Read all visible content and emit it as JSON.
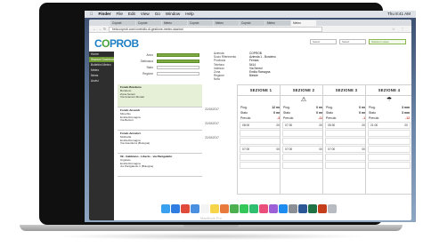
{
  "device": {
    "brand": "MacBook Pro"
  },
  "menubar": {
    "app": "Finder",
    "items": [
      "File",
      "Edit",
      "View",
      "Go",
      "Window",
      "Help"
    ],
    "status": "Thu 8:41 AM"
  },
  "browser": {
    "tabs": [
      "Coprob",
      "Coprob",
      "Meteo",
      "Coprob",
      "Meteo",
      "Coprob",
      "Meteo",
      "Meteo"
    ],
    "url": "beta.coprob.com/controllo-di-gestione-meteo-stazioni"
  },
  "app": {
    "logo_part1": "C",
    "logo_o": "O",
    "logo_part2": "PROB",
    "header": {
      "select1": "Select",
      "select2": "Select",
      "button": "Stazioni meteo"
    },
    "sidebar": [
      {
        "label": "Home",
        "active": false
      },
      {
        "label": "Stazioni Dashboard",
        "active": true
      },
      {
        "label": "Bollettini Meteo",
        "active": false
      },
      {
        "label": "Meteo",
        "active": false
      },
      {
        "label": "News",
        "active": false
      },
      {
        "label": "Avvisi",
        "active": false
      }
    ],
    "filters": [
      {
        "label": "Anno",
        "value": ""
      },
      {
        "label": "Settimana",
        "value": ""
      },
      {
        "label": "Stato",
        "value": ""
      },
      {
        "label": "Regione",
        "value": ""
      }
    ],
    "search_label": "Cerca",
    "info": {
      "labels": [
        "Azienda",
        "Socio Riferimento",
        "Provincia",
        "Telefono",
        "Indirizzo",
        "Zona",
        "Regione",
        "Nota"
      ],
      "values": [
        "COPROB",
        "Azienda 1 - Bondeno",
        "Ferrara",
        "",
        "5414",
        "Via Sereni",
        "Emilia Romagna",
        "Bietole"
      ]
    },
    "stations": [
      {
        "name": "Fondo Bondeno",
        "lines": [
          "Bondeno",
          "Zona Sereni",
          "Via Gramsci Monari"
        ],
        "active": true
      },
      {
        "name": "Fondo Ansardi",
        "lines": [
          "Minerbio",
          "Emilia Romagna",
          "Via Belzeri"
        ],
        "active": false
      },
      {
        "name": "Fondo Annalori",
        "lines": [
          "Molinella",
          "Emilia Romagna",
          "Via Giandurra (Bologna)"
        ],
        "active": false
      },
      {
        "name": "09 - Gabbiano - Liberto - via Panigaletto",
        "lines": [
          "Argelato",
          "Emilia Romagna",
          "via Panigaletto 1 (Bologna)"
        ],
        "active": false
      }
    ],
    "dates": [
      "21/08/2017",
      "21/08/2017",
      "21/08/2017"
    ],
    "sections": [
      {
        "title": "SEZIONE 1",
        "icon": "",
        "piog": "12 mm",
        "stato": "0 mm",
        "prev": "-36",
        "t1": [
          "08:00",
          "00"
        ],
        "t2": [
          "07:00",
          "00"
        ]
      },
      {
        "title": "SEZIONE 2",
        "icon": "⚠",
        "piog": "0 mm",
        "stato": "0 mm",
        "prev": "-118",
        "t1": [
          "07:30",
          "00"
        ],
        "t2": [
          "07:00",
          "00"
        ]
      },
      {
        "title": "SEZIONE 3",
        "icon": "",
        "piog": "0 mm",
        "stato": "0 mm",
        "prev": "-12",
        "t1": [
          "05:30",
          "00"
        ],
        "t2": [
          "07:00",
          "00"
        ]
      },
      {
        "title": "SEZIONE 4",
        "icon": "☂",
        "piog": "3 mm",
        "stato": "3 mm",
        "prev": "-12",
        "t1": [
          "21:00",
          "00"
        ],
        "t2": [
          "",
          ""
        ]
      }
    ],
    "section_labels": {
      "piog": "Piog.",
      "stato": "Stato",
      "prev": "Prev.idr."
    }
  },
  "colors": {
    "accent": "#6e9a31",
    "brand_blue": "#1e7fc3",
    "brand_green": "#49a33c",
    "negative": "#c43a2b"
  },
  "dock_icons": [
    "finder-icon",
    "safari-icon",
    "chrome-icon",
    "mail-icon",
    "calendar-icon",
    "notes-icon",
    "photos-icon",
    "maps-icon",
    "messages-icon",
    "facetime-icon",
    "music-icon",
    "podcasts-icon",
    "appstore-icon",
    "settings-icon",
    "word-icon",
    "excel-icon",
    "powerpoint-icon",
    "trash-icon"
  ]
}
